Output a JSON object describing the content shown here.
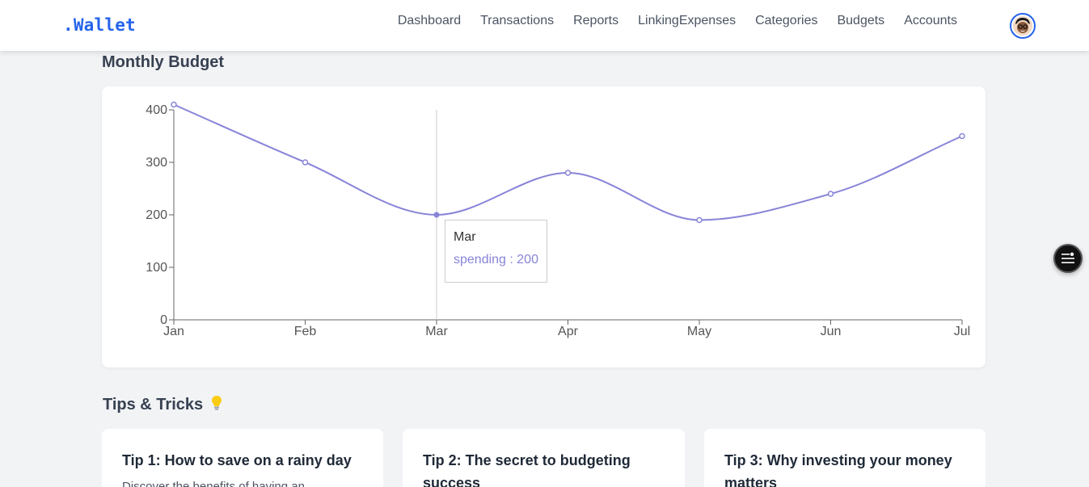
{
  "navbar": {
    "brand": ".Wallet",
    "links": [
      "Dashboard",
      "Transactions",
      "Reports",
      "LinkingExpenses",
      "Categories",
      "Budgets",
      "Accounts"
    ],
    "avatar_icon": "user-avatar-icon"
  },
  "budget_section": {
    "title": "Monthly Budget"
  },
  "chart_data": {
    "type": "line",
    "categories": [
      "Jan",
      "Feb",
      "Mar",
      "Apr",
      "May",
      "Jun",
      "Jul"
    ],
    "series": [
      {
        "name": "spending",
        "values": [
          410,
          300,
          200,
          280,
          190,
          240,
          350
        ],
        "color": "#8884d8"
      }
    ],
    "yticks": [
      0,
      100,
      200,
      300,
      400
    ],
    "ylim": [
      0,
      400
    ],
    "grid": false,
    "tooltip": {
      "title": "Mar",
      "label": "spending : 200"
    }
  },
  "float_button": {
    "icon": "menu-settings-icon"
  },
  "tips_section": {
    "title": "Tips & Tricks",
    "icon": "lightbulb-icon",
    "cards": [
      {
        "title": "Tip 1: How to save on a rainy day",
        "text": "Discover the benefits of having an"
      },
      {
        "title": "Tip 2: The secret to budgeting success",
        "text": ""
      },
      {
        "title": "Tip 3: Why investing your money matters",
        "text": ""
      }
    ]
  }
}
